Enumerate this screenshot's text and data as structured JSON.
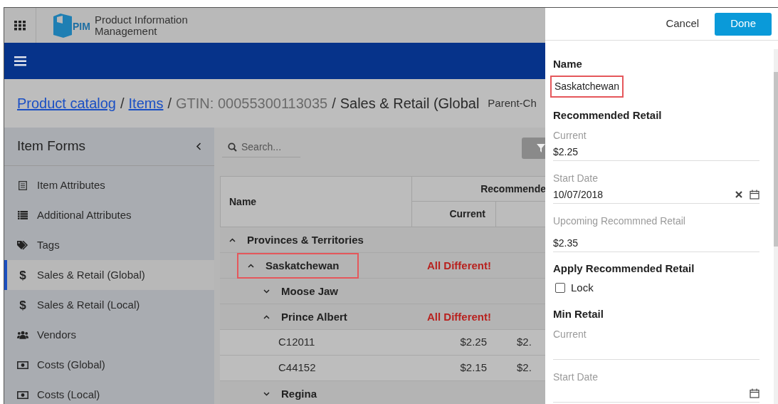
{
  "app": {
    "logo_text": "PIM",
    "title_lines": [
      "Product Information",
      "Management"
    ]
  },
  "breadcrumb": [
    {
      "text": "Product catalog",
      "kind": "link"
    },
    {
      "text": "/",
      "kind": "sep"
    },
    {
      "text": "Items",
      "kind": "link"
    },
    {
      "text": "/",
      "kind": "sep"
    },
    {
      "text": "GTIN: 00055300113035",
      "kind": "muted"
    },
    {
      "text": "/",
      "kind": "sep"
    },
    {
      "text": "Sales & Retail (Global",
      "kind": "current"
    },
    {
      "text": "Parent-Ch",
      "kind": "tag"
    }
  ],
  "sidebar": {
    "title": "Item Forms",
    "items": [
      {
        "label": "Item Attributes",
        "selected": false
      },
      {
        "label": "Additional Attributes",
        "selected": false
      },
      {
        "label": "Tags",
        "selected": false
      },
      {
        "label": "Sales & Retail (Global)",
        "selected": true,
        "icon_text": "$"
      },
      {
        "label": "Sales & Retail (Local)",
        "selected": false,
        "icon_text": "$"
      },
      {
        "label": "Vendors",
        "selected": false
      },
      {
        "label": "Costs (Global)",
        "selected": false
      },
      {
        "label": "Costs (Local)",
        "selected": false
      }
    ]
  },
  "search": {
    "placeholder": "Search..."
  },
  "table": {
    "name_column": "Name",
    "group_column": "Recommende",
    "sub_column": "Current",
    "rows": [
      {
        "name": "Provinces & Territories",
        "expanded": true,
        "highlighted": false,
        "children": [
          {
            "name": "Saskatchewan",
            "expanded": true,
            "highlighted": true,
            "status": "All Different!",
            "children": [
              {
                "name": "Moose Jaw",
                "expanded": false,
                "highlighted": false
              },
              {
                "name": "Prince Albert",
                "expanded": true,
                "highlighted": false,
                "status": "All Different!",
                "children": [
                  {
                    "name": "C12011",
                    "cells": [
                      "$2.25",
                      "$2."
                    ]
                  },
                  {
                    "name": "C44152",
                    "cells": [
                      "$2.15",
                      "$2."
                    ]
                  }
                ]
              },
              {
                "name": "Regina",
                "expanded": false,
                "highlighted": false
              }
            ]
          }
        ]
      }
    ]
  },
  "panel": {
    "buttons": [
      {
        "label": "Cancel",
        "kind": "plain"
      },
      {
        "label": "Done",
        "kind": "primary"
      }
    ],
    "items": [
      {
        "kind": "heading",
        "text": "Name"
      },
      {
        "kind": "value",
        "text": "Saskatchewan",
        "highlighted": true
      },
      {
        "kind": "heading",
        "text": "Recommended Retail"
      },
      {
        "kind": "field",
        "label": "Current",
        "value": "$2.25",
        "clearable": false,
        "date": false
      },
      {
        "kind": "field",
        "label": "Start Date",
        "value": "10/07/2018",
        "clearable": true,
        "date": true
      },
      {
        "kind": "field",
        "label": "Upcoming Recommned Retail",
        "value": "$2.35",
        "clearable": false,
        "date": false
      },
      {
        "kind": "heading",
        "text": "Apply Recommended Retail"
      },
      {
        "kind": "checkbox",
        "label": "Lock",
        "checked": false
      },
      {
        "kind": "heading",
        "text": "Min Retail"
      },
      {
        "kind": "field",
        "label": "Current",
        "clearable": false,
        "date": false
      },
      {
        "kind": "field",
        "label": "Start Date",
        "clearable": false,
        "date": true
      }
    ]
  }
}
